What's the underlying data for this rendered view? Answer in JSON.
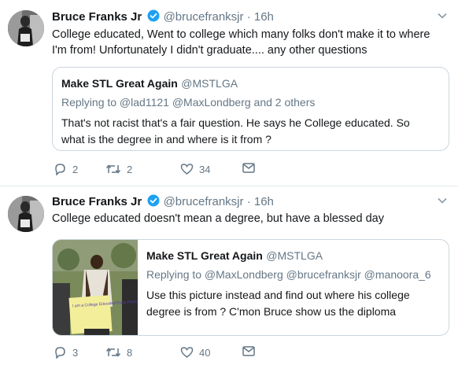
{
  "tweets": [
    {
      "name": "Bruce Franks Jr",
      "handle": "@brucefranksjr",
      "dot": "·",
      "time": "16h",
      "text": "College educated, Went to college which many folks don't make it to where I'm from! Unfortunately I didn't graduate.... any other questions",
      "quote": {
        "name": "Make STL Great Again",
        "handle": "@MSTLGA",
        "reply": "Replying to @lad1121 @MaxLondberg and 2 others",
        "text": "That's not racist that's a fair question.  He says he College educated.  So what is the degree in and where is it from ?"
      },
      "replies": "2",
      "retweets": "2",
      "likes": "34"
    },
    {
      "name": "Bruce Franks Jr",
      "handle": "@brucefranksjr",
      "dot": "·",
      "time": "16h",
      "text": "College educated doesn't mean a degree, but have a blessed day",
      "quote": {
        "name": "Make STL Great Again",
        "handle": "@MSTLGA",
        "reply": "Replying to @MaxLondberg @brucefranksjr @manoora_6",
        "text": "Use this picture instead and find out where his college degree is from ? C'mon Bruce show us the diploma",
        "sign_text": "I am a College Educated Black Person"
      },
      "replies": "3",
      "retweets": "8",
      "likes": "40"
    }
  ],
  "colors": {
    "verified": "#1da1f2",
    "muted": "#657786",
    "border": "#ccd6dd"
  }
}
